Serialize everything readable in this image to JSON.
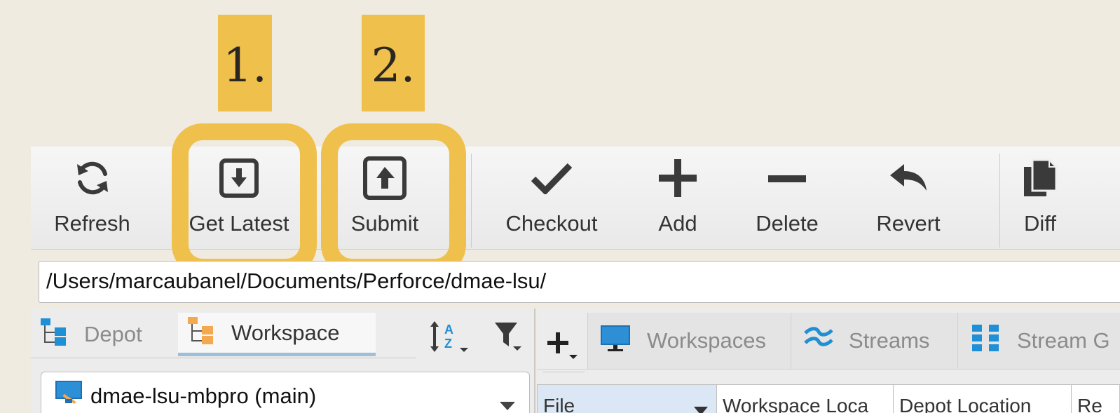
{
  "steps": {
    "first": "1.",
    "second": "2."
  },
  "toolbar": {
    "refresh": "Refresh",
    "get_latest": "Get Latest",
    "submit": "Submit",
    "checkout": "Checkout",
    "add": "Add",
    "delete": "Delete",
    "revert": "Revert",
    "diff": "Diff"
  },
  "path": "/Users/marcaubanel/Documents/Perforce/dmae-lsu/",
  "left_tabs": {
    "depot": "Depot",
    "workspace": "Workspace"
  },
  "workspace_select": {
    "value": "dmae-lsu-mbpro (main)"
  },
  "right_tabs": {
    "workspaces": "Workspaces",
    "streams": "Streams",
    "stream_graph": "Stream G"
  },
  "columns": {
    "file": "File",
    "workspace_location": "Workspace Loca",
    "depot_location": "Depot Location",
    "re": "Re"
  },
  "colors": {
    "highlight": "#f0c04c",
    "background": "#efebe1",
    "icon_dark": "#3a3a3a",
    "icon_blue": "#1f8fd6",
    "folder_orange": "#f4a850"
  },
  "icons": [
    "refresh-icon",
    "get-latest-icon",
    "submit-icon",
    "checkmark-icon",
    "plus-icon",
    "minus-icon",
    "revert-icon",
    "diff-icon",
    "depot-tree-icon",
    "workspace-tree-icon",
    "sort-az-icon",
    "filter-icon",
    "monitor-icon",
    "streams-icon",
    "stream-graph-icon"
  ]
}
